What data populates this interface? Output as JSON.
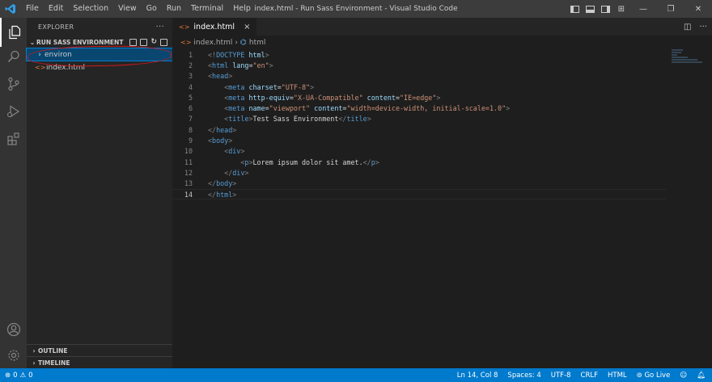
{
  "titlebar": {
    "menu": [
      "File",
      "Edit",
      "Selection",
      "View",
      "Go",
      "Run",
      "Terminal",
      "Help"
    ],
    "window_title": "index.html - Run Sass Environment - Visual Studio Code"
  },
  "sidebar": {
    "header": "EXPLORER",
    "more": "···",
    "section": "RUN SASS ENVIRONMENT",
    "tree": [
      {
        "label": "environ",
        "kind": "folder",
        "selected": true
      },
      {
        "label": "index.html",
        "kind": "html-file",
        "selected": false
      }
    ],
    "outline": "OUTLINE",
    "timeline": "TIMELINE"
  },
  "editor": {
    "tab_label": "index.html",
    "tab_close": "×",
    "breadcrumb": [
      "index.html",
      "html"
    ],
    "current_line": 14,
    "lines": [
      {
        "n": "1",
        "tokens": [
          [
            "p",
            "<!"
          ],
          [
            "t",
            "DOCTYPE"
          ],
          [
            "w",
            " "
          ],
          [
            "a",
            "html"
          ],
          [
            "p",
            ">"
          ]
        ]
      },
      {
        "n": "2",
        "tokens": [
          [
            "p",
            "<"
          ],
          [
            "t",
            "html"
          ],
          [
            "w",
            " "
          ],
          [
            "a",
            "lang"
          ],
          [
            "w",
            "="
          ],
          [
            "s",
            "\"en\""
          ],
          [
            "p",
            ">"
          ]
        ]
      },
      {
        "n": "3",
        "tokens": [
          [
            "p",
            "<"
          ],
          [
            "t",
            "head"
          ],
          [
            "p",
            ">"
          ]
        ]
      },
      {
        "n": "4",
        "tokens": [
          [
            "w",
            "    "
          ],
          [
            "p",
            "<"
          ],
          [
            "t",
            "meta"
          ],
          [
            "w",
            " "
          ],
          [
            "a",
            "charset"
          ],
          [
            "w",
            "="
          ],
          [
            "s",
            "\"UTF-8\""
          ],
          [
            "p",
            ">"
          ]
        ]
      },
      {
        "n": "5",
        "tokens": [
          [
            "w",
            "    "
          ],
          [
            "p",
            "<"
          ],
          [
            "t",
            "meta"
          ],
          [
            "w",
            " "
          ],
          [
            "a",
            "http-equiv"
          ],
          [
            "w",
            "="
          ],
          [
            "s",
            "\"X-UA-Compatible\""
          ],
          [
            "w",
            " "
          ],
          [
            "a",
            "content"
          ],
          [
            "w",
            "="
          ],
          [
            "s",
            "\"IE=edge\""
          ],
          [
            "p",
            ">"
          ]
        ]
      },
      {
        "n": "6",
        "tokens": [
          [
            "w",
            "    "
          ],
          [
            "p",
            "<"
          ],
          [
            "t",
            "meta"
          ],
          [
            "w",
            " "
          ],
          [
            "a",
            "name"
          ],
          [
            "w",
            "="
          ],
          [
            "s",
            "\"viewport\""
          ],
          [
            "w",
            " "
          ],
          [
            "a",
            "content"
          ],
          [
            "w",
            "="
          ],
          [
            "s",
            "\"width=device-width, initial-scale=1.0\""
          ],
          [
            "p",
            ">"
          ]
        ]
      },
      {
        "n": "7",
        "tokens": [
          [
            "w",
            "    "
          ],
          [
            "p",
            "<"
          ],
          [
            "t",
            "title"
          ],
          [
            "p",
            ">"
          ],
          [
            "w",
            "Test Sass Environment"
          ],
          [
            "p",
            "</"
          ],
          [
            "t",
            "title"
          ],
          [
            "p",
            ">"
          ]
        ]
      },
      {
        "n": "8",
        "tokens": [
          [
            "p",
            "</"
          ],
          [
            "t",
            "head"
          ],
          [
            "p",
            ">"
          ]
        ]
      },
      {
        "n": "9",
        "tokens": [
          [
            "p",
            "<"
          ],
          [
            "t",
            "body"
          ],
          [
            "p",
            ">"
          ]
        ]
      },
      {
        "n": "10",
        "tokens": [
          [
            "w",
            "    "
          ],
          [
            "p",
            "<"
          ],
          [
            "t",
            "div"
          ],
          [
            "p",
            ">"
          ]
        ]
      },
      {
        "n": "11",
        "tokens": [
          [
            "w",
            "        "
          ],
          [
            "p",
            "<"
          ],
          [
            "t",
            "p"
          ],
          [
            "p",
            ">"
          ],
          [
            "w",
            "Lorem ipsum dolor sit amet."
          ],
          [
            "p",
            "</"
          ],
          [
            "t",
            "p"
          ],
          [
            "p",
            ">"
          ]
        ]
      },
      {
        "n": "12",
        "tokens": [
          [
            "w",
            "    "
          ],
          [
            "p",
            "</"
          ],
          [
            "t",
            "div"
          ],
          [
            "p",
            ">"
          ]
        ]
      },
      {
        "n": "13",
        "tokens": [
          [
            "p",
            "</"
          ],
          [
            "t",
            "body"
          ],
          [
            "p",
            ">"
          ]
        ]
      },
      {
        "n": "14",
        "tokens": [
          [
            "p",
            "</"
          ],
          [
            "t",
            "html"
          ],
          [
            "p",
            ">"
          ]
        ]
      }
    ]
  },
  "statusbar": {
    "errors": "0",
    "warnings": "0",
    "position": "Ln 14, Col 8",
    "spaces": "Spaces: 4",
    "encoding": "UTF-8",
    "eol": "CRLF",
    "language": "HTML",
    "golive": "Go Live"
  },
  "colors": {
    "accent": "#007acc",
    "selection": "#094771",
    "annotation": "#d01a1a"
  },
  "icons": [
    "vscode-logo-icon",
    "explorer-icon",
    "search-icon",
    "source-control-icon",
    "run-debug-icon",
    "extensions-icon",
    "account-icon",
    "settings-gear-icon"
  ]
}
